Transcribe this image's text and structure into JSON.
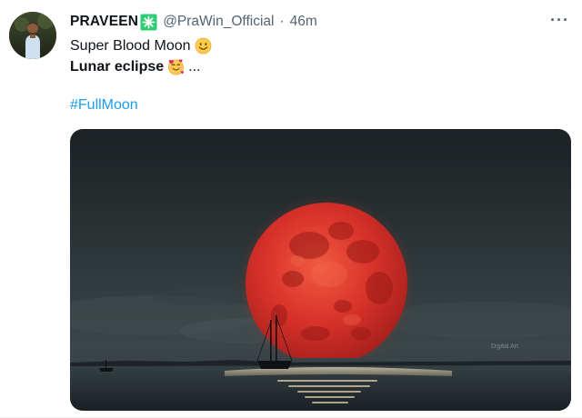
{
  "user": {
    "name": "PRAVEEN",
    "handle": "@PraWin_Official",
    "separator": "·",
    "time": "46m"
  },
  "tweet": {
    "line1": "Super Blood Moon",
    "line1_emoji": "smiling-face-emoji",
    "line2": "Lunar eclipse",
    "line2_emoji": "smiling-face-with-hearts-emoji",
    "line2_suffix": "...",
    "hashtag": "#FullMoon"
  },
  "menu": {
    "more_label": "···"
  },
  "media": {
    "description_icon": "blood-moon-photo",
    "watermark": "Digital Art"
  },
  "colors": {
    "link": "#1d9bf0",
    "text": "#0f1419",
    "muted": "#536471",
    "verified_badge": "#2ecc71",
    "moon": "#d8322a"
  }
}
